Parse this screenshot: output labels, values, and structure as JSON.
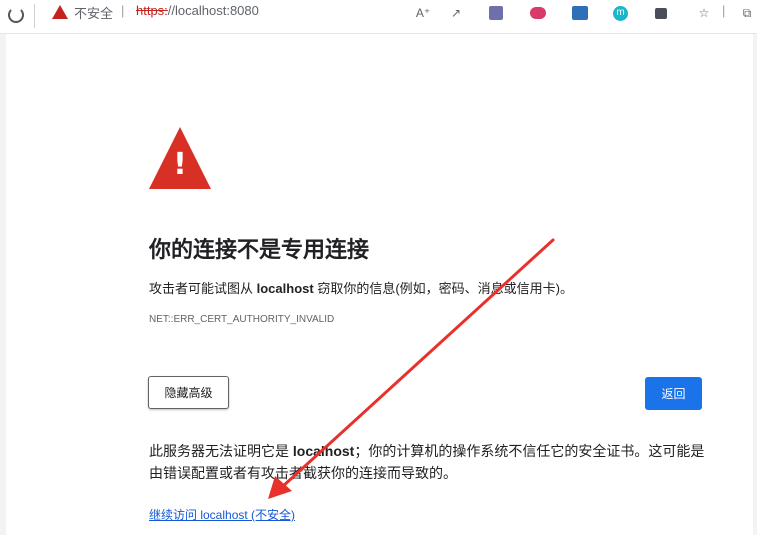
{
  "toolbar": {
    "unsafe_label": "不安全",
    "separator": "|",
    "url_scheme": "https:",
    "url_rest": "//localhost:8080",
    "text_size_glyph": "A⁺",
    "voice_glyph": "↗",
    "ext_m_letter": "m",
    "favorites_glyph": "☆",
    "collections_glyph": "⧉"
  },
  "page": {
    "title": "你的连接不是专用连接",
    "desc_prefix": "攻击者可能试图从 ",
    "desc_host": "localhost",
    "desc_suffix": " 窃取你的信息(例如，密码、消息或信用卡)。",
    "error_code": "NET::ERR_CERT_AUTHORITY_INVALID",
    "hide_advanced_label": "隐藏高级",
    "back_label": "返回",
    "detail_prefix": "此服务器无法证明它是 ",
    "detail_host": "localhost",
    "detail_suffix": "；你的计算机的操作系统不信任它的安全证书。这可能是由错误配置或者有攻击者截获你的连接而导致的。",
    "proceed_link": "继续访问 localhost (不安全)"
  },
  "colors": {
    "warning_red": "#d93025",
    "primary_blue": "#1a73e8",
    "link_blue": "#1558d6",
    "annotation_red": "#e8312a"
  }
}
